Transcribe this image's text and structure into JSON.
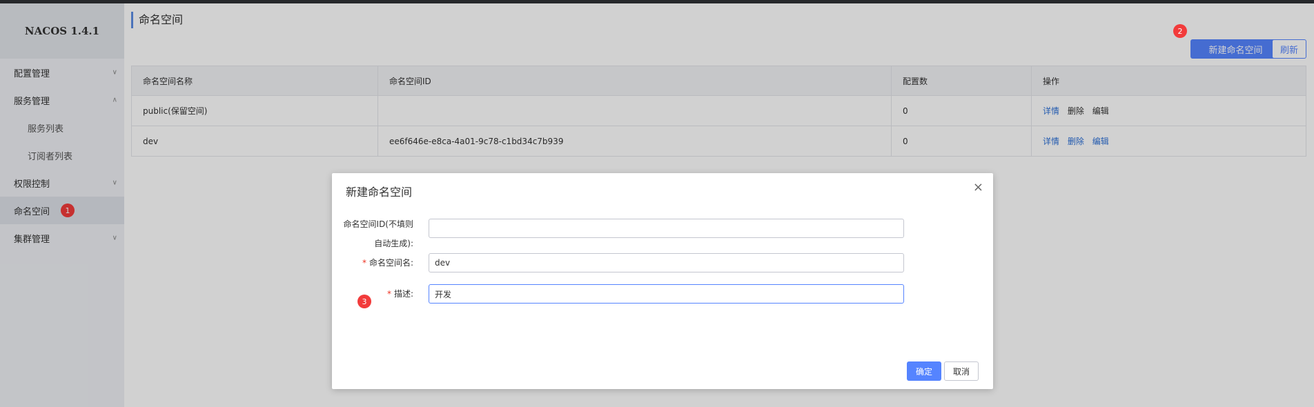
{
  "app": {
    "brand": "NACOS 1.4.1"
  },
  "sidebar": {
    "items": [
      {
        "label": "配置管理",
        "chevron": "down"
      },
      {
        "label": "服务管理",
        "chevron": "up"
      },
      {
        "label": "服务列表"
      },
      {
        "label": "订阅者列表"
      },
      {
        "label": "权限控制",
        "chevron": "down"
      },
      {
        "label": "命名空间"
      },
      {
        "label": "集群管理",
        "chevron": "down"
      }
    ],
    "active": "命名空间"
  },
  "steps": {
    "one": "1",
    "two": "2",
    "three": "3"
  },
  "page": {
    "title": "命名空间"
  },
  "toolbar": {
    "new_label": "新建命名空间",
    "refresh_label": "刷新"
  },
  "table": {
    "headers": [
      "命名空间名称",
      "命名空间ID",
      "配置数",
      "操作"
    ],
    "rows": [
      {
        "name": "public(保留空间)",
        "id": "",
        "count": "0",
        "ops": [
          "详情",
          "删除",
          "编辑"
        ]
      },
      {
        "name": "dev",
        "id": "ee6f646e-e8ca-4a01-9c78-c1bd34c7b939",
        "count": "0",
        "ops": [
          "详情",
          "删除",
          "编辑"
        ]
      }
    ]
  },
  "dialog": {
    "title": "新建命名空间",
    "close_icon": "×",
    "id_label_line1": "命名空间ID(不填则",
    "id_label_line2": "自动生成):",
    "id_value": "",
    "required_mark": "*",
    "name_label": "命名空间名:",
    "name_value": "dev",
    "desc_label": "描述:",
    "desc_value": "开发",
    "ok_label": "确定",
    "cancel_label": "取消"
  },
  "colors": {
    "primary": "#5584ff",
    "badge": "#f23b3b",
    "link": "#2c6fd6"
  }
}
